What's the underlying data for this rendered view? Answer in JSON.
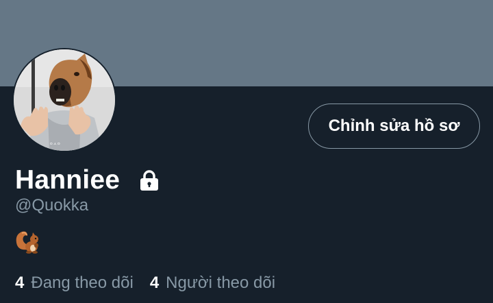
{
  "colors": {
    "banner": "#657786",
    "background": "#15202b",
    "text_primary": "#ffffff",
    "text_secondary": "#8899a6",
    "button_border": "#8899a6"
  },
  "profile": {
    "avatar_icon": "horse-mask-avatar",
    "edit_button_label": "Chỉnh sửa hồ sơ",
    "display_name": "Hanniee",
    "protected_icon": "lock-icon",
    "username": "@Quokka",
    "bio_icon": "squirrel-emoji"
  },
  "stats": {
    "following_count": "4",
    "following_label": "Đang theo dõi",
    "followers_count": "4",
    "followers_label": "Người theo dõi"
  }
}
